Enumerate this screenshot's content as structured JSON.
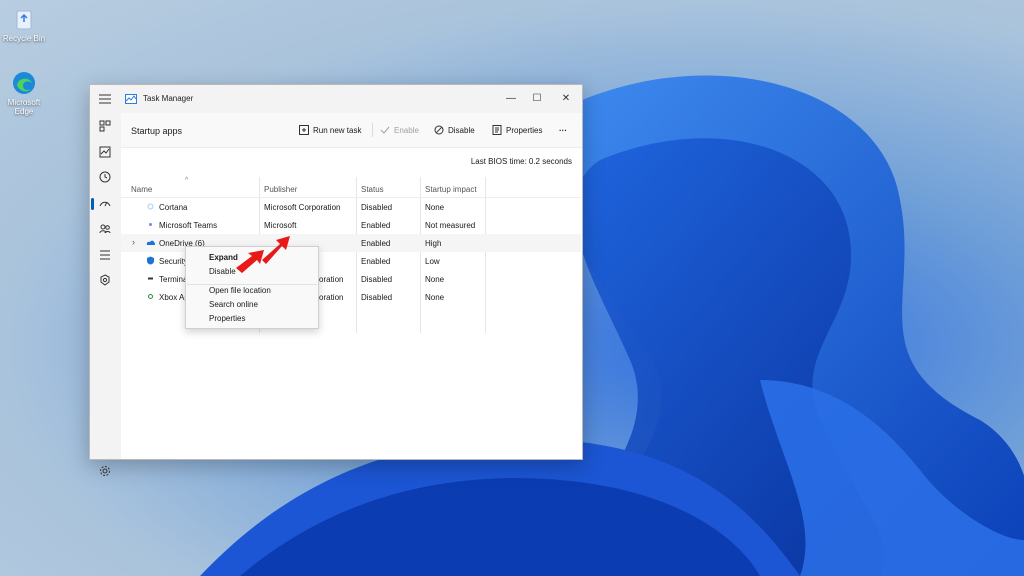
{
  "desktop": {
    "icons": [
      {
        "label": "Recycle Bin",
        "icon": "recycle-bin-icon"
      },
      {
        "label": "Microsoft Edge",
        "icon": "edge-icon"
      }
    ]
  },
  "window": {
    "title": "Task Manager",
    "controls": {
      "minimize": "—",
      "maximize": "☐",
      "close": "✕"
    }
  },
  "sidebar": {
    "items": [
      {
        "name": "processes",
        "icon": "processes-icon"
      },
      {
        "name": "performance",
        "icon": "performance-icon"
      },
      {
        "name": "app-history",
        "icon": "history-icon"
      },
      {
        "name": "startup-apps",
        "icon": "startup-icon",
        "selected": true
      },
      {
        "name": "users",
        "icon": "users-icon"
      },
      {
        "name": "details",
        "icon": "details-icon"
      },
      {
        "name": "services",
        "icon": "services-icon"
      },
      {
        "name": "settings",
        "icon": "gear-icon"
      }
    ]
  },
  "header": {
    "title": "Startup apps",
    "run_new_task": "Run new task",
    "enable": "Enable",
    "disable": "Disable",
    "properties": "Properties",
    "more": "···"
  },
  "bios": {
    "label": "Last BIOS time:",
    "value": "0.2 seconds"
  },
  "table": {
    "columns": [
      "Name",
      "Publisher",
      "Status",
      "Startup impact"
    ],
    "rows": [
      {
        "name": "Cortana",
        "publisher": "Microsoft Corporation",
        "status": "Disabled",
        "impact": "None"
      },
      {
        "name": "Microsoft Teams",
        "publisher": "Microsoft",
        "status": "Enabled",
        "impact": "Not measured"
      },
      {
        "name": "OneDrive (6)",
        "publisher": "",
        "status": "Enabled",
        "impact": "High"
      },
      {
        "name": "Security",
        "publisher": "",
        "status": "Enabled",
        "impact": "Low"
      },
      {
        "name": "Terminal",
        "publisher": "oration",
        "status": "Disabled",
        "impact": "None"
      },
      {
        "name": "Xbox Ap",
        "publisher": "oration",
        "status": "Disabled",
        "impact": "None"
      }
    ]
  },
  "context_menu": {
    "items": [
      "Expand",
      "Disable",
      "Open file location",
      "Search online",
      "Properties"
    ]
  },
  "colors": {
    "accent": "#005fb8",
    "arrow": "#e81919"
  }
}
